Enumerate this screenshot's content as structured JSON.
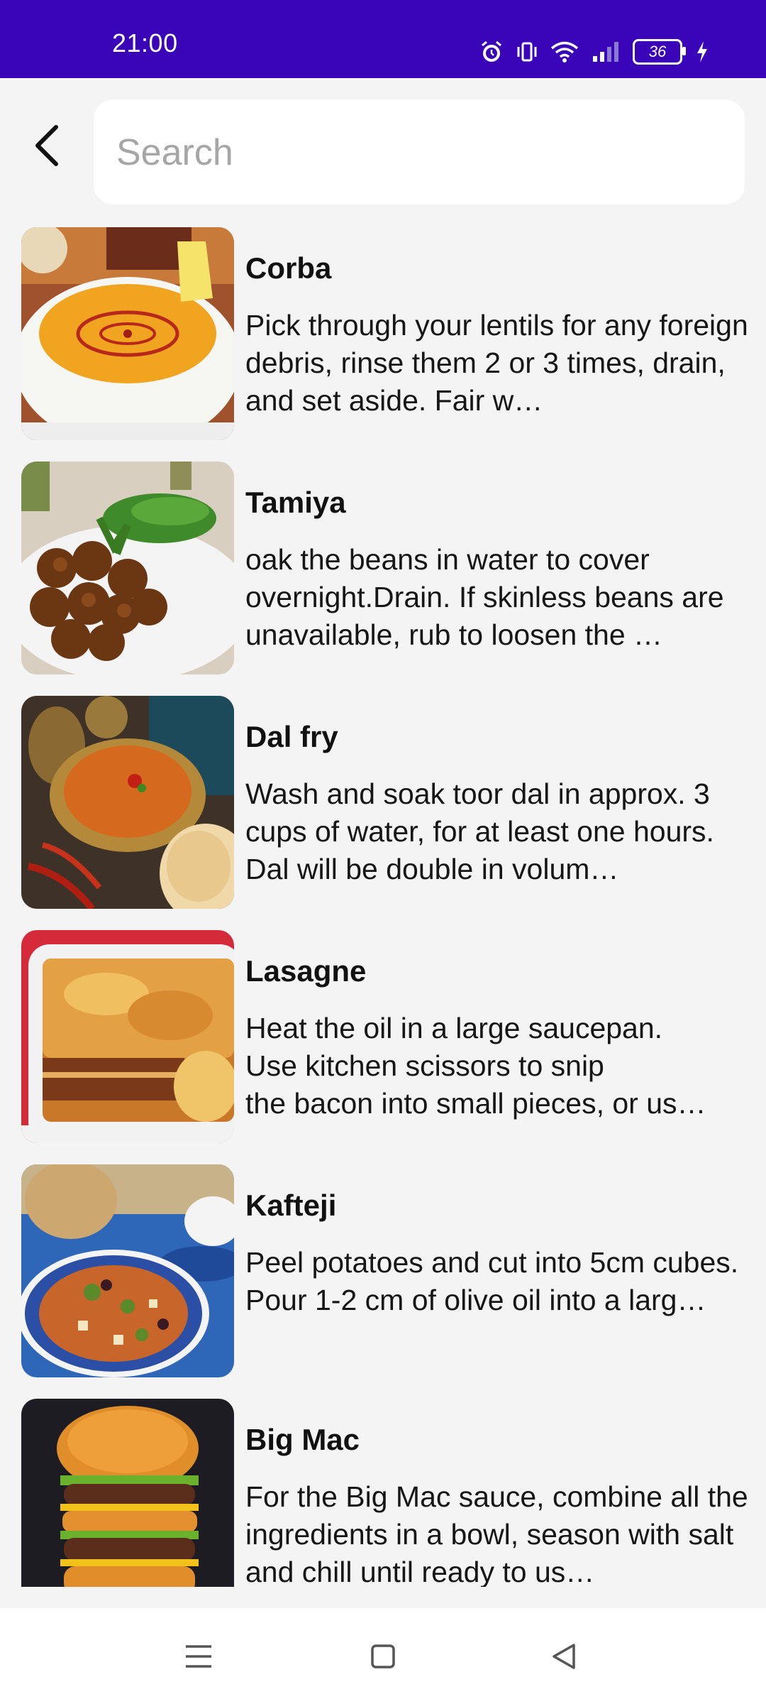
{
  "status_bar": {
    "time": "21:00",
    "battery_level": "36",
    "icons": [
      "alarm-icon",
      "vibrate-icon",
      "wifi-icon",
      "signal-icon",
      "battery-icon",
      "charging-icon"
    ],
    "background_color": "#3a05b8"
  },
  "search": {
    "placeholder": "Search",
    "value": ""
  },
  "recipes": [
    {
      "title": "Corba",
      "description": "Pick through your lentils for any foreign debris, rinse them 2 or 3 times, drain, and set aside.  Fair w…"
    },
    {
      "title": "Tamiya",
      "description": "oak the beans in water to cover overnight.Drain. If skinless beans are unavailable, rub to loosen the …"
    },
    {
      "title": "Dal fry",
      "description": "Wash and soak toor dal in approx. 3 cups of water, for at least one hours. Dal will be double in volum…"
    },
    {
      "title": "Lasagne",
      "description": "Heat the oil in a large saucepan.\nUse kitchen scissors to snip\nthe bacon into small pieces, or us…"
    },
    {
      "title": "Kafteji",
      "description": "Peel potatoes and cut into 5cm cubes.\nPour 1-2 cm of olive oil into a larg…"
    },
    {
      "title": "Big Mac",
      "description": "For the Big Mac sauce, combine all the ingredients in a bowl, season with salt and chill until ready to us…"
    }
  ],
  "nav_bar": {
    "icons": [
      "menu-icon",
      "home-icon",
      "back-triangle-icon"
    ]
  }
}
